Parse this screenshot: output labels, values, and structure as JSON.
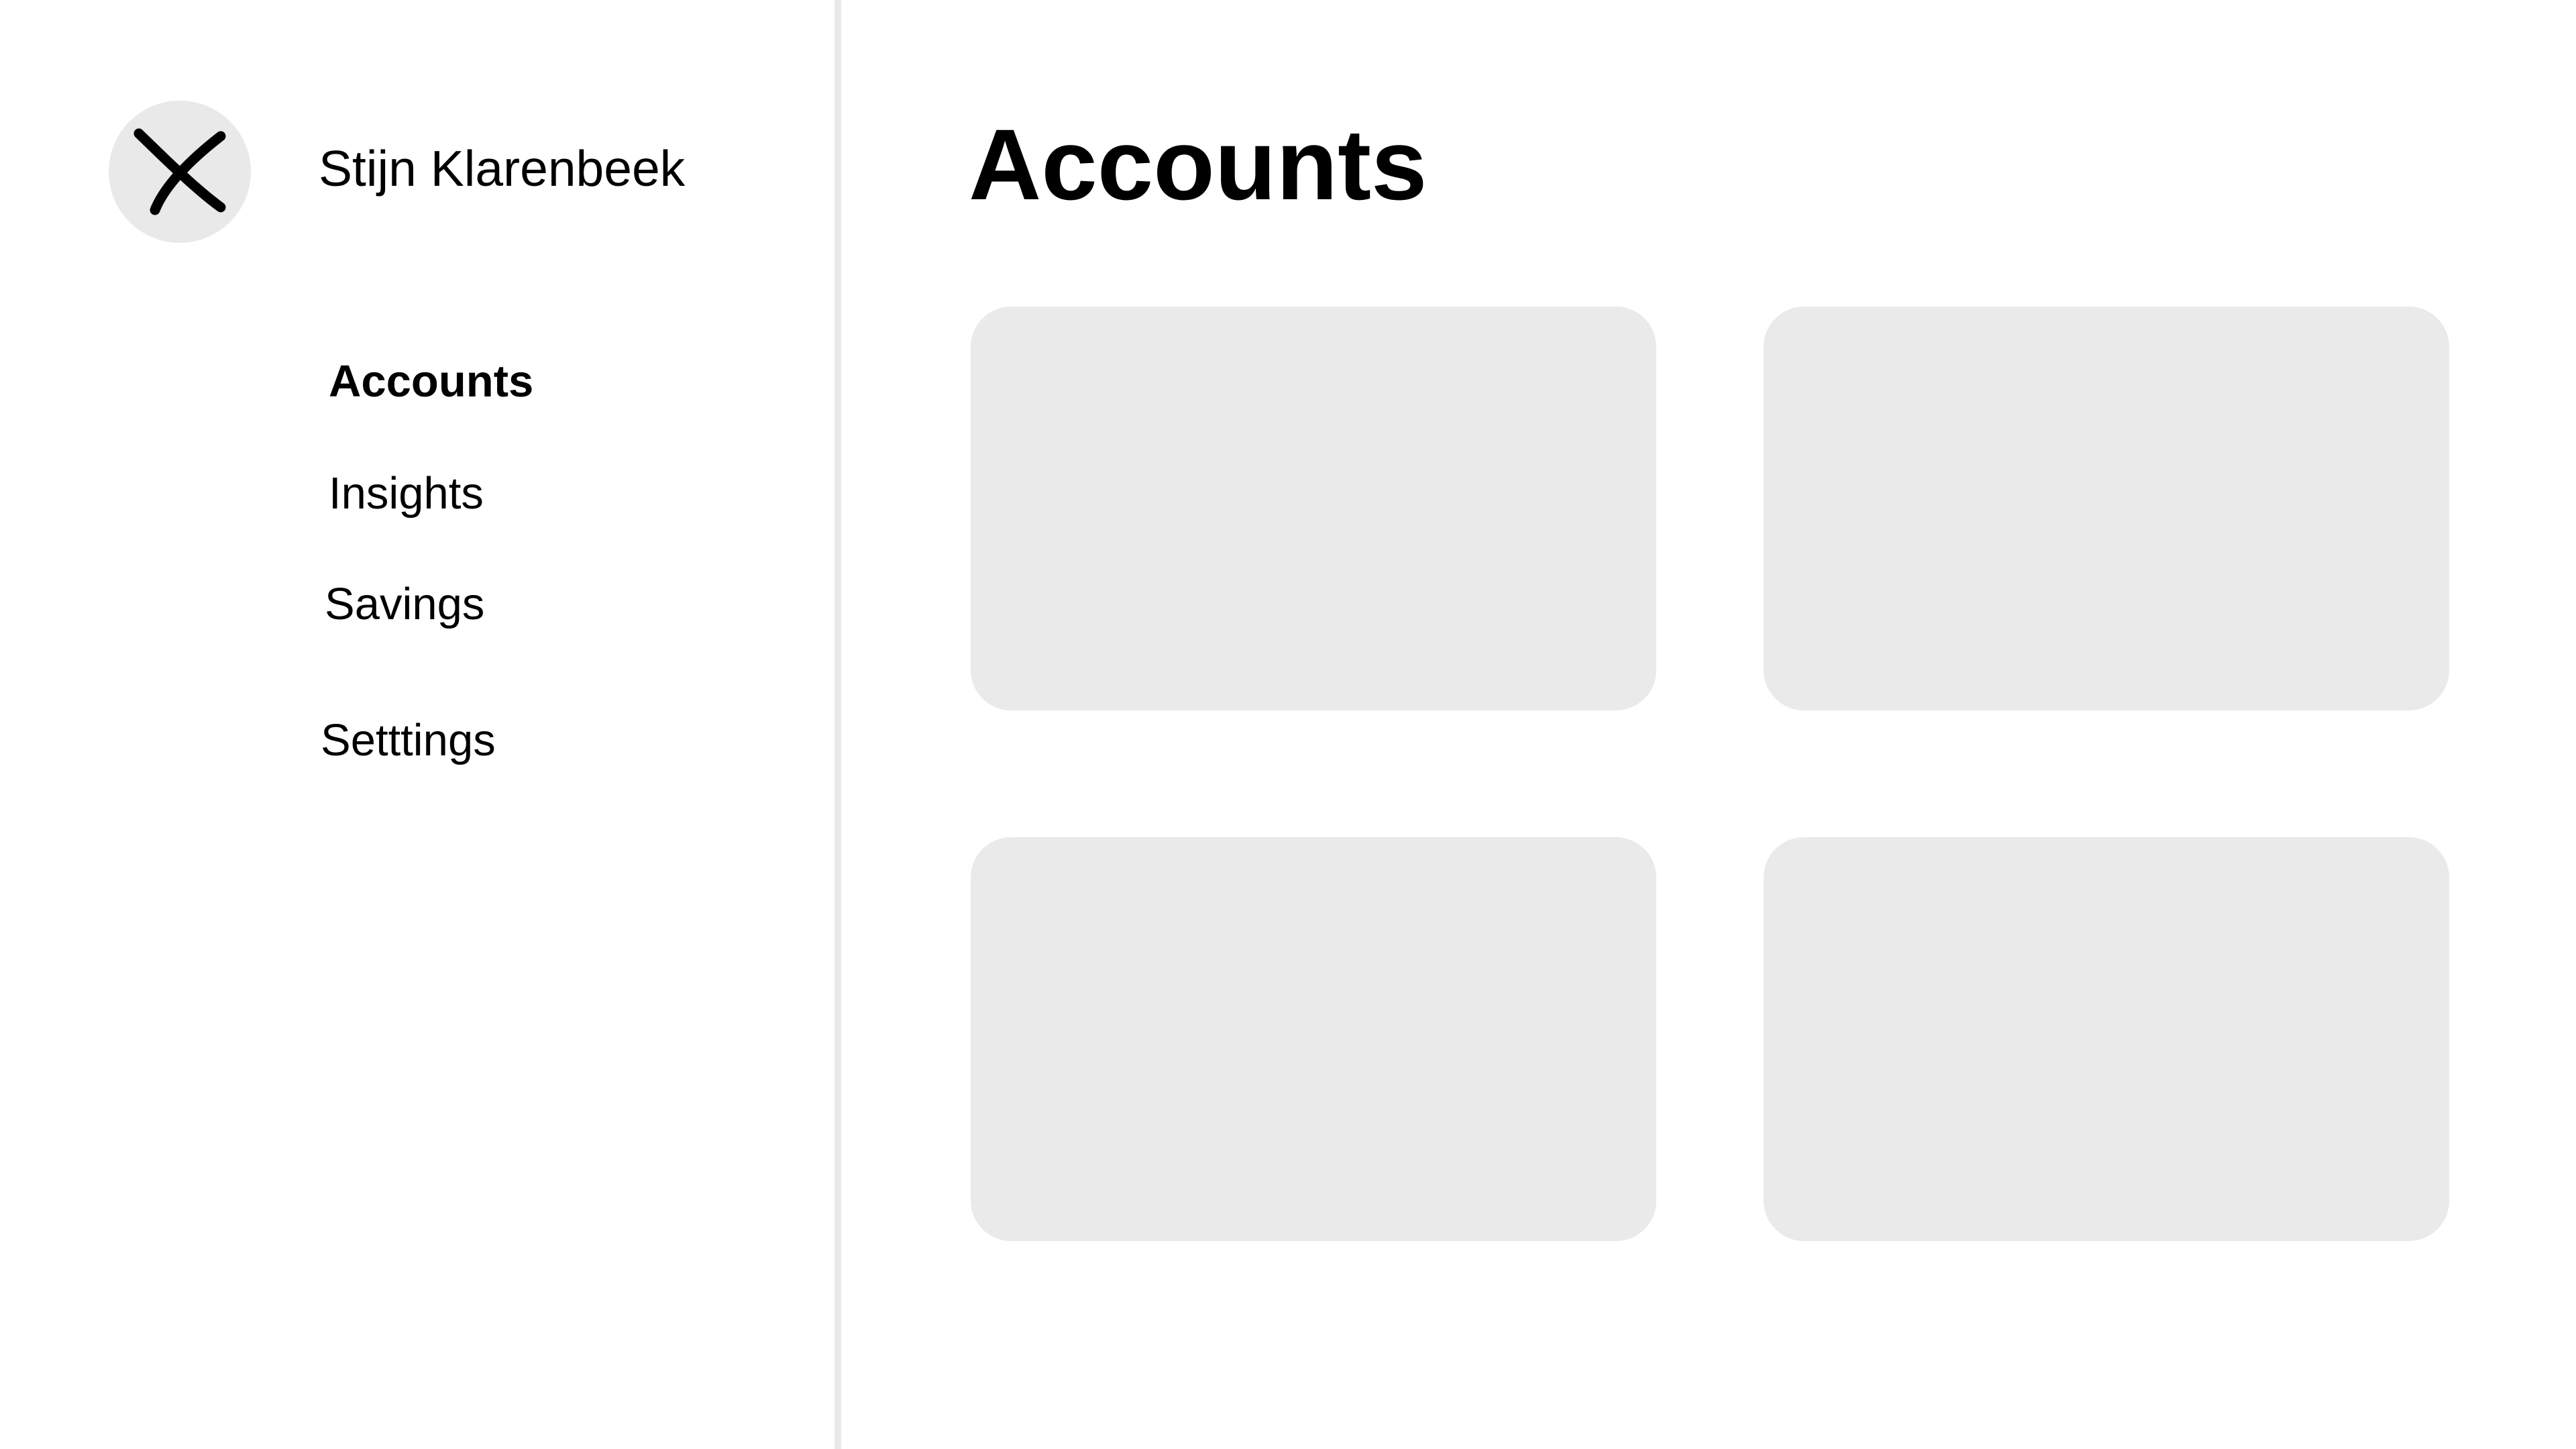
{
  "sidebar": {
    "close_icon": "close-icon",
    "user_name": "Stijn Klarenbeek",
    "nav": [
      {
        "label": "Accounts",
        "active": true
      },
      {
        "label": "Insights",
        "active": false
      },
      {
        "label": "Savings",
        "active": false
      },
      {
        "label": "Setttings",
        "active": false
      }
    ]
  },
  "main": {
    "title": "Accounts",
    "cards": [
      {
        "id": "account-card-1"
      },
      {
        "id": "account-card-2"
      },
      {
        "id": "account-card-3"
      },
      {
        "id": "account-card-4"
      }
    ]
  },
  "colors": {
    "background": "#ffffff",
    "placeholder_gray": "#eaeaea",
    "divider_gray": "#e9e9e9",
    "text": "#000000"
  }
}
